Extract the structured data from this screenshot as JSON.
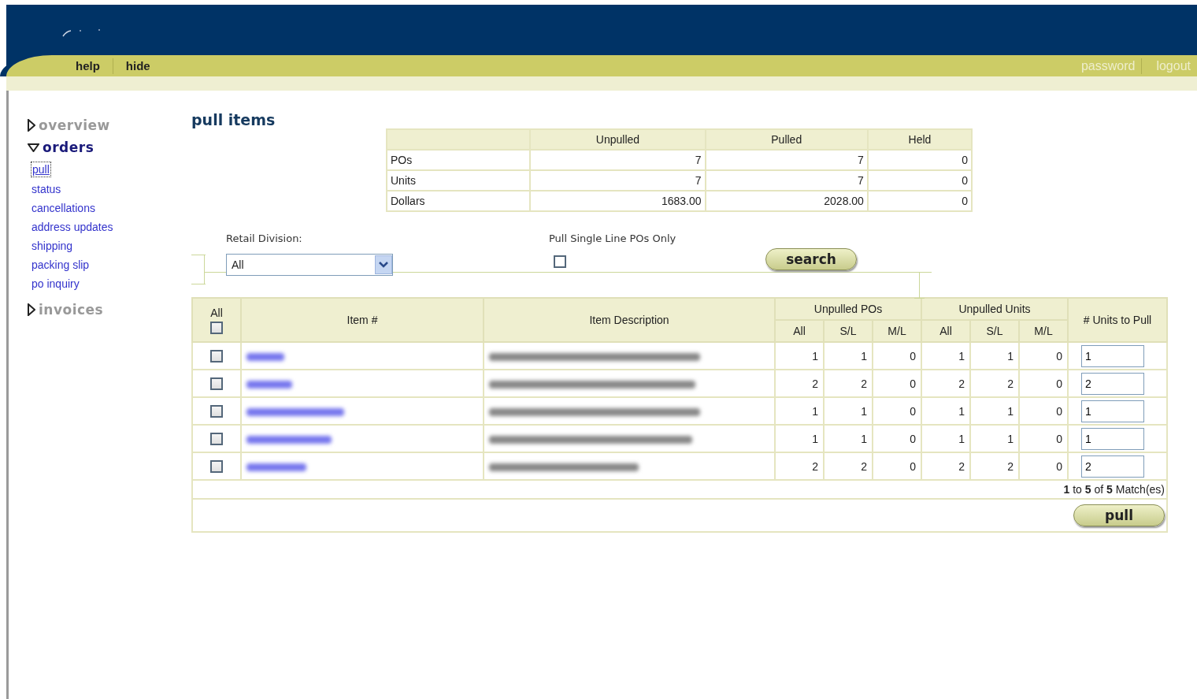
{
  "header": {
    "left_links": [
      "help",
      "hide"
    ],
    "right_links": [
      "password",
      "logout"
    ]
  },
  "sidebar": {
    "sections": [
      {
        "label": "overview",
        "expanded": false
      },
      {
        "label": "orders",
        "expanded": true,
        "items": [
          {
            "label": "pull",
            "selected": true
          },
          {
            "label": "status",
            "selected": false
          },
          {
            "label": "cancellations",
            "selected": false
          },
          {
            "label": "address updates",
            "selected": false
          },
          {
            "label": "shipping",
            "selected": false
          },
          {
            "label": "packing slip",
            "selected": false
          },
          {
            "label": "po inquiry",
            "selected": false
          }
        ]
      },
      {
        "label": "invoices",
        "expanded": false
      }
    ]
  },
  "page_title": "pull items",
  "summary": {
    "columns": [
      "Unpulled",
      "Pulled",
      "Held"
    ],
    "rows": [
      {
        "label": "POs",
        "values": [
          "7",
          "7",
          "0"
        ]
      },
      {
        "label": "Units",
        "values": [
          "7",
          "7",
          "0"
        ]
      },
      {
        "label": "Dollars",
        "values": [
          "1683.00",
          "2028.00",
          "0"
        ]
      }
    ]
  },
  "filters": {
    "division_label": "Retail Division:",
    "division_value": "All",
    "single_line_label": "Pull Single Line POs Only",
    "single_line_checked": false,
    "search_button": "search"
  },
  "items_table": {
    "select_all_label": "All",
    "select_all_checked": false,
    "columns": [
      "Item #",
      "Item Description"
    ],
    "groups": [
      {
        "label": "Unpulled POs",
        "sub": [
          "All",
          "S/L",
          "M/L"
        ]
      },
      {
        "label": "Unpulled Units",
        "sub": [
          "All",
          "S/L",
          "M/L"
        ]
      }
    ],
    "units_column": "# Units to Pull",
    "rows": [
      {
        "checked": false,
        "item_blurred": true,
        "description_blurred": true,
        "po_counts": [
          "1",
          "1",
          "0"
        ],
        "unit_counts": [
          "1",
          "1",
          "0"
        ],
        "units_to_pull": "1"
      },
      {
        "checked": false,
        "item_blurred": true,
        "description_blurred": true,
        "po_counts": [
          "2",
          "2",
          "0"
        ],
        "unit_counts": [
          "2",
          "2",
          "0"
        ],
        "units_to_pull": "2"
      },
      {
        "checked": false,
        "item_blurred": true,
        "description_blurred": true,
        "po_counts": [
          "1",
          "1",
          "0"
        ],
        "unit_counts": [
          "1",
          "1",
          "0"
        ],
        "units_to_pull": "1"
      },
      {
        "checked": false,
        "item_blurred": true,
        "description_blurred": true,
        "po_counts": [
          "1",
          "1",
          "0"
        ],
        "unit_counts": [
          "1",
          "1",
          "0"
        ],
        "units_to_pull": "1"
      },
      {
        "checked": false,
        "item_blurred": true,
        "description_blurred": true,
        "po_counts": [
          "2",
          "2",
          "0"
        ],
        "unit_counts": [
          "2",
          "2",
          "0"
        ],
        "units_to_pull": "2"
      }
    ],
    "matches": "**1** to **5** of **5** Match(es)",
    "pull_button": "pull"
  }
}
